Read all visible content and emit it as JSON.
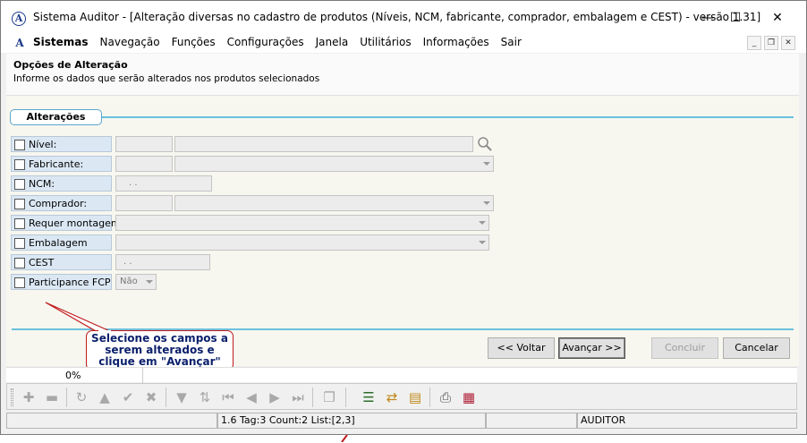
{
  "window": {
    "title": "Sistema Auditor - [Alteração diversas no cadastro de produtos (Níveis, NCM, fabricante, comprador,  embalagem e CEST) - versão 1.31]",
    "app_icon_letter": "A",
    "minimize": "—",
    "maximize": "☐",
    "close": "✕"
  },
  "menu": {
    "icon_letter": "A",
    "items": [
      "Sistemas",
      "Navegação",
      "Funções",
      "Configurações",
      "Janela",
      "Utilitários",
      "Informações",
      "Sair"
    ],
    "mdi_minimize": "_",
    "mdi_restore": "❐",
    "mdi_close": "✕"
  },
  "header": {
    "title": "Opções de Alteração",
    "subtitle": "Informe os dados que serão alterados nos produtos selecionados"
  },
  "group": {
    "label": "Alterações"
  },
  "fields": [
    {
      "label": "Nível:"
    },
    {
      "label": "Fabricante:"
    },
    {
      "label": "NCM:",
      "value": ".   ."
    },
    {
      "label": "Comprador:"
    },
    {
      "label": "Requer montagem:"
    },
    {
      "label": "Embalagem"
    },
    {
      "label": "CEST",
      "value": ".   ."
    },
    {
      "label": "Participance FCP",
      "value": "Não"
    }
  ],
  "callout": {
    "text": "Selecione os campos a serem alterados e clique em \"Avançar\""
  },
  "buttons": {
    "back": "<< Voltar",
    "next": "Avançar >>",
    "finish": "Concluir",
    "cancel": "Cancelar"
  },
  "progress": {
    "percent_label": "0%"
  },
  "status": {
    "info": "1.6 Tag:3 Count:2 List:[2,3]",
    "user": "AUDITOR"
  },
  "colors": {
    "accent_line": "#6cc0dc",
    "label_bg": "#dbe8f4",
    "callout_border": "#c01a1a",
    "callout_text": "#0a1f6b"
  }
}
